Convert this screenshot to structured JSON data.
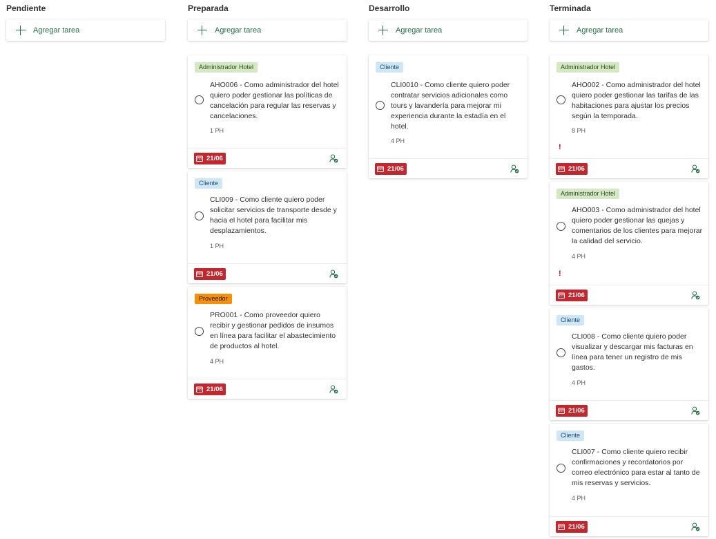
{
  "columns": [
    {
      "title": "Pendiente",
      "add_label": "Agregar tarea"
    },
    {
      "title": "Preparada",
      "add_label": "Agregar tarea"
    },
    {
      "title": "Desarrollo",
      "add_label": "Agregar tarea"
    },
    {
      "title": "Terminada",
      "add_label": "Agregar tarea"
    }
  ],
  "cards": {
    "aho006": {
      "tag": "Administrador Hotel",
      "text": "AHO006 - Como administrador del hotel quiero poder gestionar las políticas de cancelación para regular las reservas y cancelaciones.",
      "points": "1 PH",
      "due": "21/06"
    },
    "cli009": {
      "tag": "Cliente",
      "text": "CLI009 - Como cliente quiero poder solicitar servicios de transporte desde y hacia el hotel para facilitar mis desplazamientos.",
      "points": "1 PH",
      "due": "21/06"
    },
    "pro001": {
      "tag": "Proveedor",
      "text": "PRO001 - Como proveedor quiero recibir y gestionar pedidos de insumos en línea para facilitar el abastecimiento de productos al hotel.",
      "points": "4 PH",
      "due": "21/06"
    },
    "cli0010": {
      "tag": "Cliente",
      "text": "CLI0010 - Como cliente quiero poder contratar servicios adicionales como tours y lavandería para mejorar mi experiencia durante la estadía en el hotel.",
      "points": "4 PH",
      "due": "21/06"
    },
    "aho002": {
      "tag": "Administrador Hotel",
      "text": "AHO002 - Como administrador del hotel quiero poder gestionar las tarifas de las habitaciones para ajustar los precios según la temporada.",
      "points": "8 PH",
      "priority": "!",
      "due": "21/06"
    },
    "aho003": {
      "tag": "Administrador Hotel",
      "text": "AHO003 - Como administrador del hotel quiero poder gestionar las quejas y comentarios de los clientes para mejorar la calidad del servicio.",
      "points": "4 PH",
      "priority": "!",
      "due": "21/06"
    },
    "cli008": {
      "tag": "Cliente",
      "text": "CLI008 - Como cliente quiero poder visualizar y descargar mis facturas en línea para tener un registro de mis gastos.",
      "points": "4 PH",
      "due": "21/06"
    },
    "cli007": {
      "tag": "Cliente",
      "text": "CLI007 - Como cliente quiero recibir confirmaciones y recordatorios por correo electrónico para estar al tanto de mis reservas y servicios.",
      "points": "4 PH",
      "due": "21/06"
    }
  },
  "icons": {
    "add": "plus-icon",
    "complete": "circle-icon",
    "due": "calendar-icon",
    "assign": "assign-person-icon"
  },
  "colors": {
    "accent": "#217346",
    "due_bg": "#c4262e",
    "tag_admin": "#d3e8c3",
    "tag_cliente": "#cfe6f7",
    "tag_proveedor": "#f4900c",
    "priority": "#c50f1f"
  }
}
